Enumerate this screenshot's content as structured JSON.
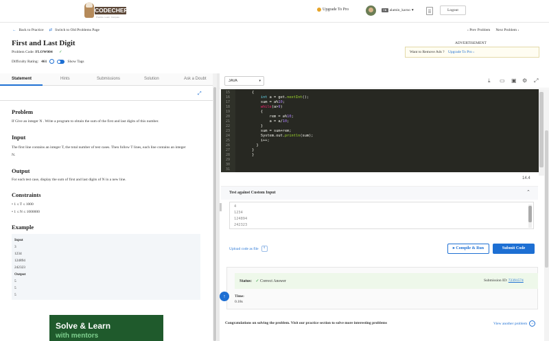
{
  "header": {
    "logo_text": "CODECHEF",
    "logo_tagline": "Practice. Learn. Compete",
    "upgrade_label": "Upgrade To Pro",
    "stars": "1★",
    "username": "alamin_karno",
    "logout_label": "Logout"
  },
  "nav": {
    "back_label": "Back to Practice",
    "switch_label": "Switch to Old Problems Page",
    "prev_label": "Prev Problem",
    "next_label": "Next Problem"
  },
  "problem": {
    "title": "First and Last Digit",
    "code_label": "Problem Code:",
    "code_value": "FLOW004",
    "difficulty_label": "Difficulty Rating:",
    "difficulty_value": "461",
    "show_tags": "Show Tags"
  },
  "advert": {
    "label": "ADVERTISEMENT",
    "remove_text": "Want to Remove Ads ?",
    "upgrade_link": "Upgrade To Pro"
  },
  "tabs": [
    "Statement",
    "Hints",
    "Submissions",
    "Solution",
    "Ask a Doubt"
  ],
  "statement": {
    "problem_heading": "Problem",
    "problem_text": "If Give an integer N . Write a program to obtain the sum of the first and last digits of this number.",
    "input_heading": "Input",
    "input_text_1": "The first line contains an integer T, the total number of test cases. Then follow T lines, each line contains an integer",
    "input_text_2": "N.",
    "output_heading": "Output",
    "output_text": "For each test case, display the sum of first and last digits of N in a new line.",
    "constraints_heading": "Constraints",
    "constraint_1": "1 ≤ T ≤ 1000",
    "constraint_2": "1 ≤ N ≤ 1000000",
    "example_heading": "Example",
    "example_input_label": "Input",
    "example_input": [
      "3",
      "1234",
      "124894",
      "242323"
    ],
    "example_output_label": "Output",
    "example_output": [
      "5",
      "5",
      "5"
    ]
  },
  "ad_banner": {
    "line1": "Solve & Learn",
    "line2": "with mentors"
  },
  "editor": {
    "language": "JAVA",
    "version": "14.4",
    "line_numbers": [
      "15",
      "16",
      "17",
      "18",
      "19",
      "20",
      "21",
      "22",
      "23",
      "24",
      "25",
      "26",
      "27",
      "28",
      "29",
      "30",
      "31"
    ],
    "lines": [
      "{",
      "    int a = get.nextInt();",
      "    sum = a%10;",
      "    while(a>9)",
      "    {",
      "        rem = a%10;",
      "        a = a/10;",
      "    }",
      "    sum = sum+rem;",
      "    System.out.println(sum);",
      "    i++;",
      "  }",
      "}",
      "}",
      "",
      "",
      ""
    ]
  },
  "custom_input": {
    "title": "Test against Custom Input",
    "lines": [
      "4",
      "1234",
      "124894",
      "242323"
    ]
  },
  "actions": {
    "upload_label": "Upload code as file",
    "run_label": "Compile & Run",
    "submit_label": "Submit Code"
  },
  "result": {
    "status_label": "Status:",
    "status_value": "Correct Answer",
    "submission_label": "Submission ID:",
    "submission_id": "72391574",
    "time_label": "Time:",
    "time_value": "0.18s"
  },
  "footer": {
    "congrats": "Congratulations on solving the problem. Visit our practice section to solve more interesting problems",
    "view_another": "View another problem"
  },
  "colors": {
    "accent": "#1d6fd3",
    "success": "#2e9e3e",
    "editor_bg": "#272822"
  }
}
